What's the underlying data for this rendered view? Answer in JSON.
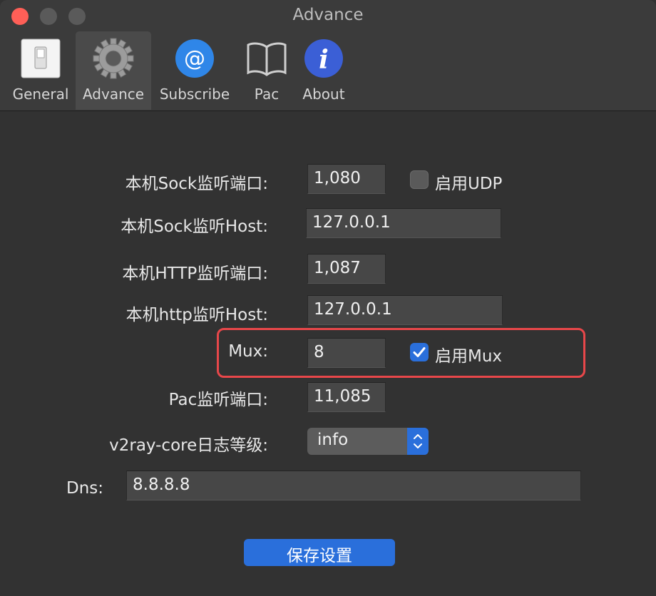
{
  "window": {
    "title": "Advance"
  },
  "tabs": [
    {
      "label": "General",
      "icon": "toggle-switch-icon"
    },
    {
      "label": "Advance",
      "icon": "gear-icon"
    },
    {
      "label": "Subscribe",
      "icon": "at-sign-icon"
    },
    {
      "label": "Pac",
      "icon": "book-icon"
    },
    {
      "label": "About",
      "icon": "info-icon"
    }
  ],
  "form": {
    "sock_port": {
      "label": "本机Sock监听端口:",
      "value": "1,080"
    },
    "udp": {
      "label": "启用UDP",
      "checked": false
    },
    "sock_host": {
      "label": "本机Sock监听Host:",
      "value": "127.0.0.1"
    },
    "http_port": {
      "label": "本机HTTP监听端口:",
      "value": "1,087"
    },
    "http_host": {
      "label": "本机http监听Host:",
      "value": "127.0.0.1"
    },
    "mux": {
      "label": "Mux:",
      "value": "8"
    },
    "mux_enable": {
      "label": "启用Mux",
      "checked": true
    },
    "pac_port": {
      "label": "Pac监听端口:",
      "value": "11,085"
    },
    "log_level": {
      "label": "v2ray-core日志等级:",
      "value": "info"
    },
    "dns": {
      "label": "Dns:",
      "value": "8.8.8.8"
    }
  },
  "save_button": {
    "label": "保存设置"
  },
  "colors": {
    "accent": "#2a6fdb",
    "highlight": "#e8474a",
    "close": "#fe5f57"
  }
}
